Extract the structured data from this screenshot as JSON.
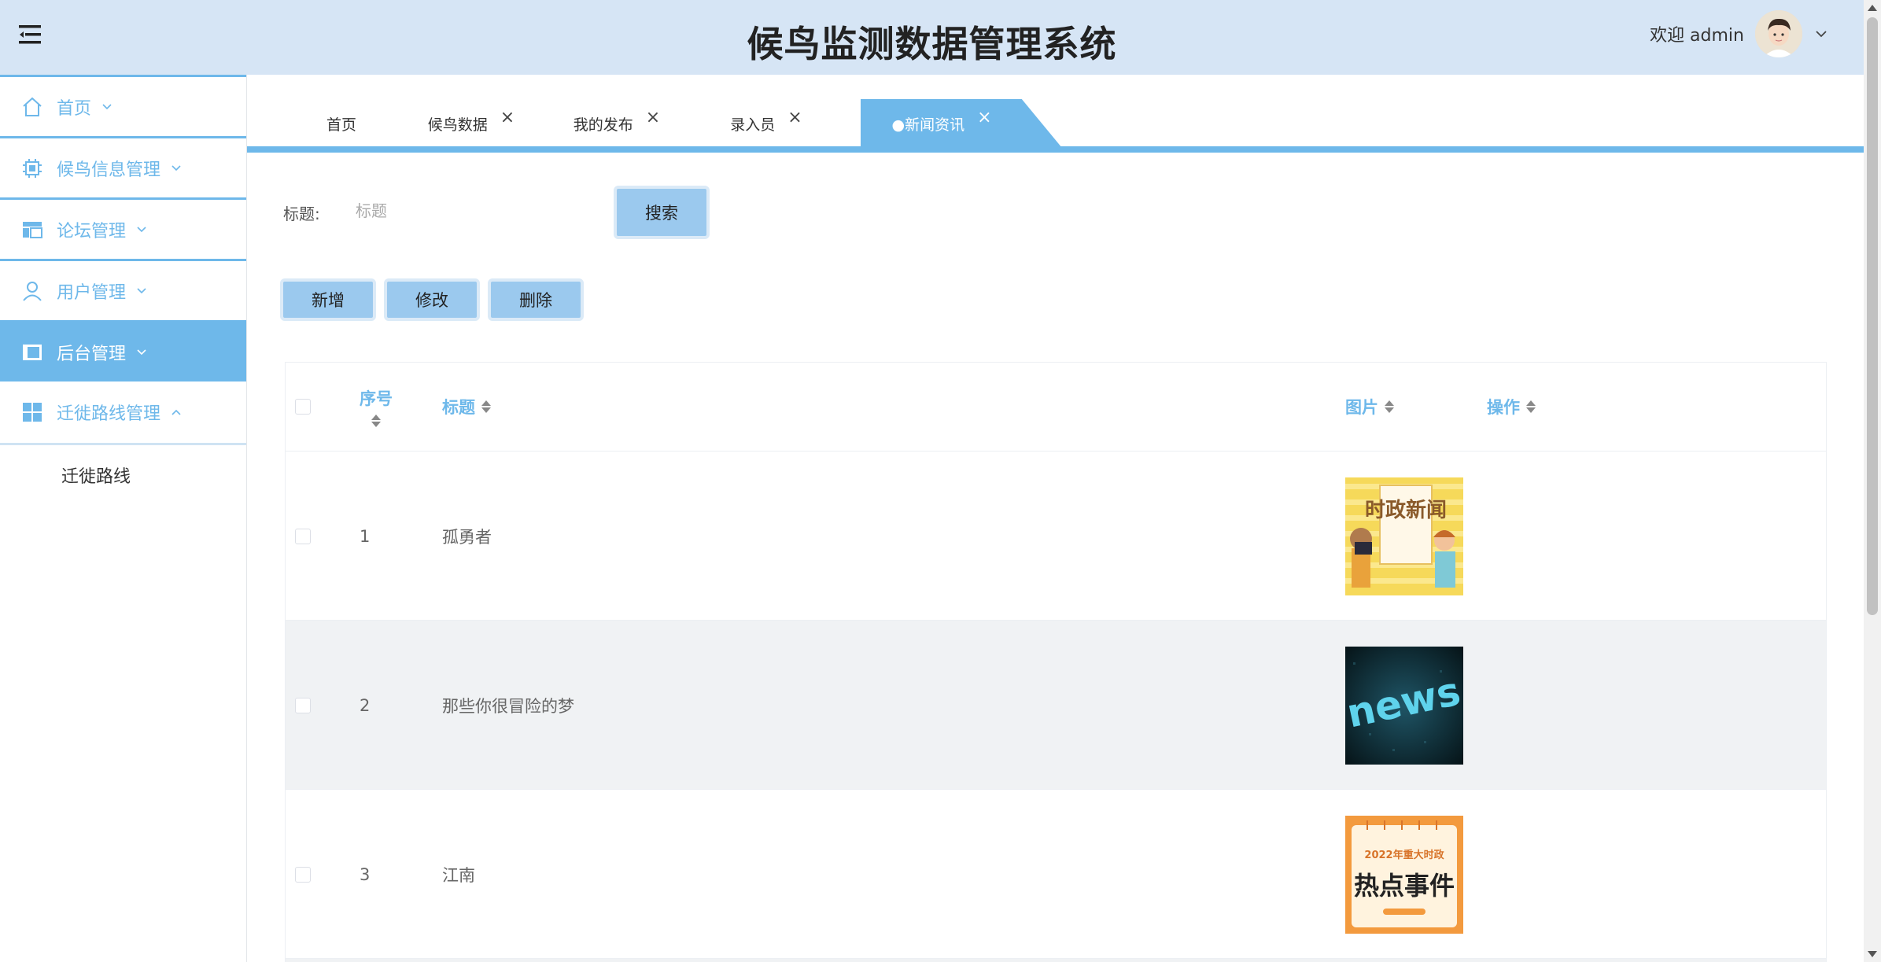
{
  "header": {
    "title": "候鸟监测数据管理系统",
    "welcome": "欢迎 admin",
    "menu_icon": "hamburger-icon",
    "avatar_icon": "user-avatar",
    "dropdown_icon": "chevron-down-icon"
  },
  "sidebar": {
    "items": [
      {
        "label": "首页",
        "icon": "home-icon"
      },
      {
        "label": "候鸟信息管理",
        "icon": "chip-icon"
      },
      {
        "label": "论坛管理",
        "icon": "layout-icon"
      },
      {
        "label": "用户管理",
        "icon": "user-icon"
      },
      {
        "label": "后台管理",
        "icon": "panel-icon",
        "active": true
      },
      {
        "label": "迁徙路线管理",
        "icon": "grid-icon",
        "expanded": true
      }
    ],
    "submenu": [
      {
        "label": "迁徙路线"
      }
    ]
  },
  "tabs": [
    {
      "label": "首页",
      "closable": false
    },
    {
      "label": "候鸟数据",
      "closable": true
    },
    {
      "label": "我的发布",
      "closable": true
    },
    {
      "label": "录入员",
      "closable": true
    },
    {
      "label": "●新闻资讯",
      "closable": true,
      "active": true
    }
  ],
  "tab_close": "×",
  "search": {
    "label": "标题:",
    "placeholder": "标题",
    "button": "搜索"
  },
  "actions": {
    "add": "新增",
    "edit": "修改",
    "delete": "删除"
  },
  "table": {
    "headers": {
      "index": "序号",
      "title": "标题",
      "image": "图片",
      "ops": "操作"
    },
    "rows": [
      {
        "index": "1",
        "title": "孤勇者",
        "image": "时政新闻"
      },
      {
        "index": "2",
        "title": "那些你很冒险的梦",
        "image": "news"
      },
      {
        "index": "3",
        "title": "江南",
        "image_line1": "2022年重大时政",
        "image_line2": "热点事件"
      }
    ]
  },
  "colors": {
    "accent": "#6eb8ea",
    "header_bg": "#d6e5f5",
    "button_bg": "#9bc9ee"
  }
}
